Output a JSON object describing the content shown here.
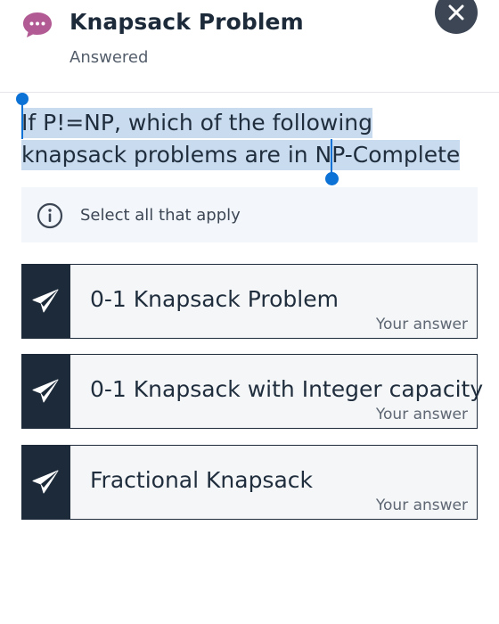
{
  "header": {
    "title": "Knapsack Problem",
    "status": "Answered",
    "icon": "chat-bubble-icon",
    "close_icon": "close-icon"
  },
  "question": {
    "text": "If P!=NP, which of the following knapsack problems are in NP-Complete",
    "selection_highlight_color": "#c9dcef"
  },
  "info": {
    "icon": "info-icon",
    "text": "Select all that apply"
  },
  "options": [
    {
      "label": "0-1 Knapsack Problem",
      "sub": "Your answer",
      "icon": "send-icon"
    },
    {
      "label": "0-1 Knapsack with Integer capacity",
      "sub": "Your answer",
      "icon": "send-icon"
    },
    {
      "label": "Fractional Knapsack",
      "sub": "Your answer",
      "icon": "send-icon"
    }
  ],
  "colors": {
    "accent_dark": "#1c2a3a",
    "chat_icon": "#b15a93",
    "selection_handle": "#0d72d6"
  }
}
